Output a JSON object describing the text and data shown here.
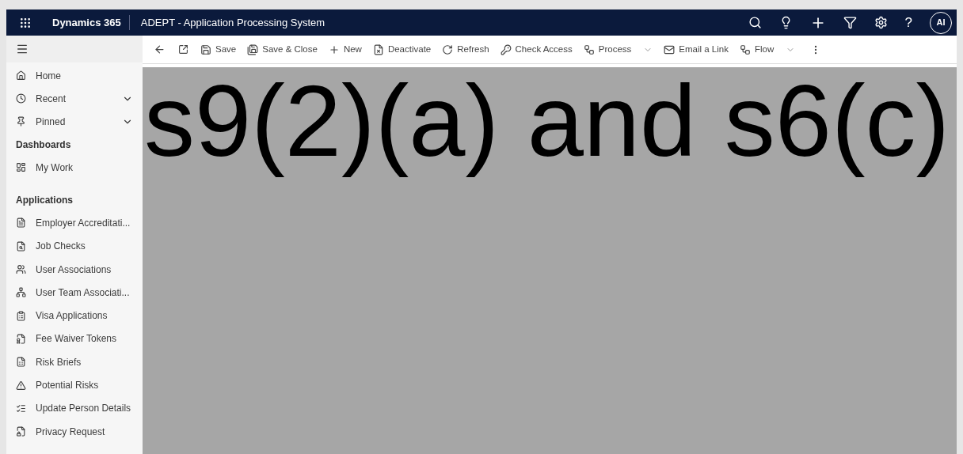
{
  "app_bar": {
    "product": "Dynamics 365",
    "app_title": "ADEPT - Application Processing System",
    "help_label": "?",
    "avatar": "AI"
  },
  "command_bar": {
    "items": [
      {
        "label": "Save",
        "has_menu": false
      },
      {
        "label": "Save & Close",
        "has_menu": false
      },
      {
        "label": "New",
        "has_menu": false
      },
      {
        "label": "Deactivate",
        "has_menu": false
      },
      {
        "label": "Refresh",
        "has_menu": false
      },
      {
        "label": "Check Access",
        "has_menu": false
      },
      {
        "label": "Process",
        "has_menu": true
      },
      {
        "label": "Email a Link",
        "has_menu": false
      },
      {
        "label": "Flow",
        "has_menu": true
      }
    ]
  },
  "sidebar": {
    "items": [
      {
        "label": "Home",
        "expandable": false
      },
      {
        "label": "Recent",
        "expandable": true
      },
      {
        "label": "Pinned",
        "expandable": true
      }
    ],
    "sections": [
      {
        "title": "Dashboards",
        "items": [
          {
            "label": "My Work"
          }
        ]
      },
      {
        "title": "Applications",
        "items": [
          {
            "label": "Employer Accreditati..."
          },
          {
            "label": "Job Checks"
          },
          {
            "label": "User Associations"
          },
          {
            "label": "User Team Associati..."
          },
          {
            "label": "Visa Applications"
          },
          {
            "label": "Fee Waiver Tokens"
          },
          {
            "label": "Risk Briefs"
          },
          {
            "label": "Potential Risks"
          },
          {
            "label": "Update Person Details"
          },
          {
            "label": "Privacy Request"
          }
        ]
      }
    ]
  },
  "content": {
    "redaction_text": "s9(2)(a) and s6(c)"
  }
}
